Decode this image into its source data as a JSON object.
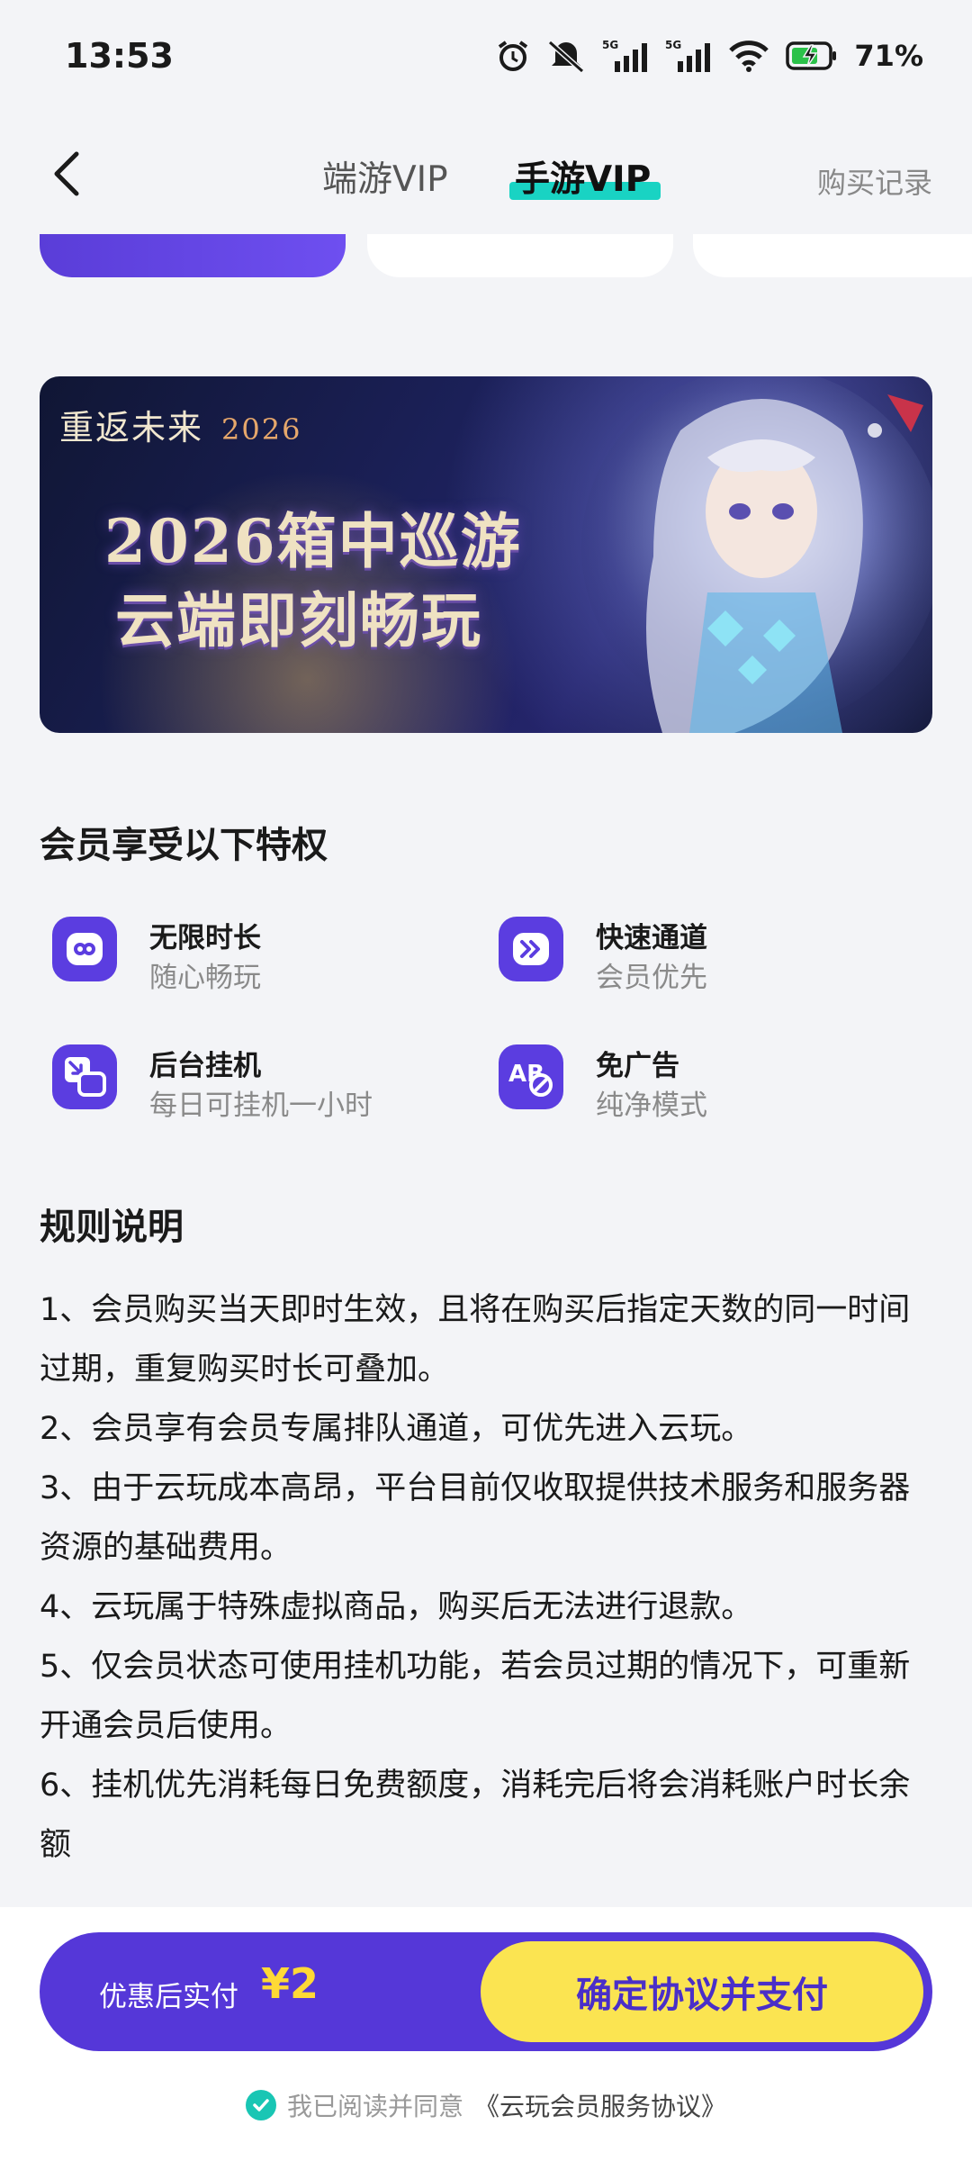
{
  "status_bar": {
    "time": "13:53",
    "battery": "71%",
    "icons": [
      "alarm-icon",
      "mute-icon",
      "signal-5g-icon",
      "signal-5g-icon",
      "wifi-icon",
      "battery-charging-icon"
    ]
  },
  "nav": {
    "back_icon": "chevron-left-icon",
    "tabs": [
      {
        "label": "端游VIP",
        "active": false
      },
      {
        "label": "手游VIP",
        "active": true
      }
    ],
    "purchase_record": "购买记录"
  },
  "banner": {
    "logo_text": "重返未来",
    "logo_year": "2026",
    "line1": "2026箱中巡游",
    "line2": "云端即刻畅玩"
  },
  "privileges": {
    "title": "会员享受以下特权",
    "items": [
      {
        "name": "无限时长",
        "desc": "随心畅玩",
        "icon": "infinity-icon"
      },
      {
        "name": "快速通道",
        "desc": "会员优先",
        "icon": "fast-forward-icon"
      },
      {
        "name": "后台挂机",
        "desc": "每日可挂机一小时",
        "icon": "minimize-window-icon"
      },
      {
        "name": "免广告",
        "desc": "纯净模式",
        "icon": "no-ads-icon"
      }
    ]
  },
  "rules": {
    "title": "规则说明",
    "items": [
      "1、会员购买当天即时生效，且将在购买后指定天数的同一时间过期，重复购买时长可叠加。",
      "2、会员享有会员专属排队通道，可优先进入云玩。",
      "3、由于云玩成本高昂，平台目前仅收取提供技术服务和服务器资源的基础费用。",
      "4、云玩属于特殊虚拟商品，购买后无法进行退款。",
      "5、仅会员状态可使用挂机功能，若会员过期的情况下，可重新开通会员后使用。",
      "6、挂机优先消耗每日免费额度，消耗完后将会消耗账户时长余额"
    ]
  },
  "payment": {
    "label": "优惠后实付",
    "price": "¥2",
    "button": "确定协议并支付"
  },
  "agreement": {
    "checked": true,
    "text": "我已阅读并同意",
    "link": "《云玩会员服务协议》"
  },
  "colors": {
    "accent": "#5537d8",
    "tab_highlight": "#19d3c3",
    "pay_button": "#fbe451",
    "price": "#ffd936"
  }
}
